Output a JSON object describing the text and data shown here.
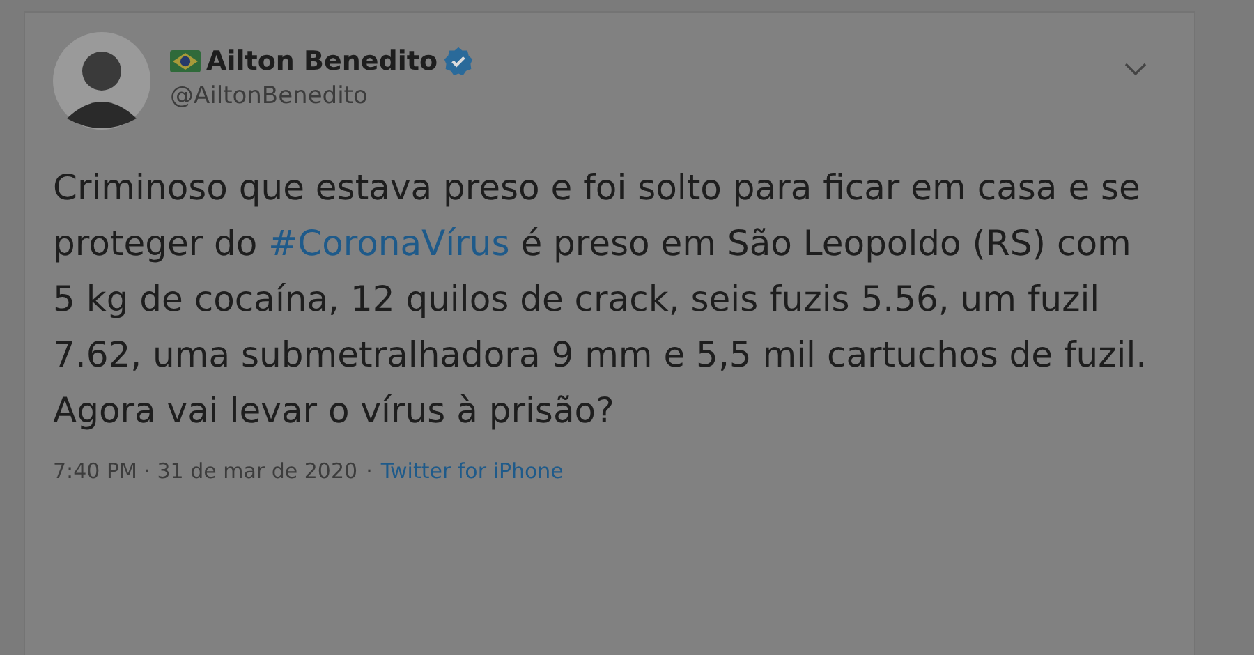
{
  "tweet": {
    "author": {
      "name": "Ailton Benedito",
      "handle": "@AiltonBenedito",
      "verified": true
    },
    "text": [
      {
        "kind": "plain",
        "text": "Criminoso que estava preso e foi solto para ficar em casa e se proteger do "
      },
      {
        "kind": "hashtag",
        "text": "#CoronaVírus"
      },
      {
        "kind": "plain",
        "text": " é preso em São Leopoldo (RS) com 5 kg de cocaína, 12 quilos de crack, seis fuzis 5.56, um fuzil 7.62, uma submetralhadora 9 mm e 5,5 mil cartuchos de fuzil. Agora vai levar o vírus à prisão?"
      }
    ],
    "time": "7:40 PM · 31 de mar de 2020",
    "separator": "·",
    "source": "Twitter for iPhone"
  }
}
